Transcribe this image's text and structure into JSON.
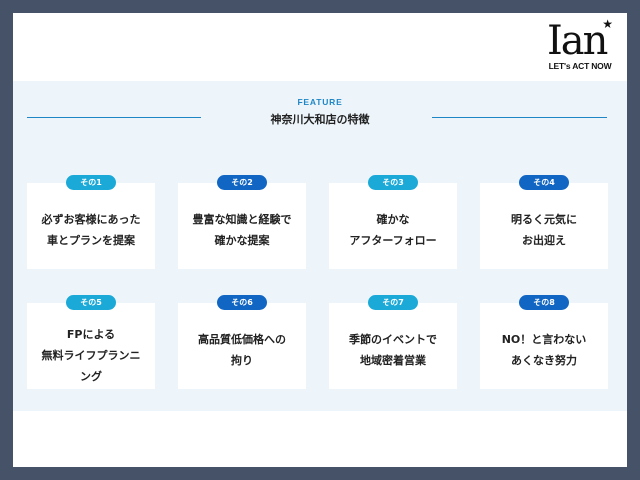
{
  "brand": {
    "logo_text": "Ian",
    "star": "★",
    "tagline": "LET's ACT NOW"
  },
  "section": {
    "eyebrow": "FEATURE",
    "heading": "神奈川大和店の特徴"
  },
  "features": [
    {
      "badge": "その1",
      "text": "必ずお客様にあった\n車とプランを提案"
    },
    {
      "badge": "その2",
      "text": "豊富な知識と経験で\n確かな提案"
    },
    {
      "badge": "その3",
      "text": "確かな\nアフターフォロー"
    },
    {
      "badge": "その4",
      "text": "明るく元気に\nお出迎え"
    },
    {
      "badge": "その5",
      "text": "FPによる\n無料ライフプランニ\nング"
    },
    {
      "badge": "その6",
      "text": "高品質低価格への\n拘り"
    },
    {
      "badge": "その7",
      "text": "季節のイベントで\n地域密着営業"
    },
    {
      "badge": "その8",
      "text": "NO！と言わない\nあくなき努力"
    }
  ],
  "colors": {
    "frame": "#455267",
    "section_bg": "#edf5fb",
    "accent_light": "#1ba9d8",
    "accent_dark": "#1266c3",
    "eyebrow": "#1f86c6"
  }
}
